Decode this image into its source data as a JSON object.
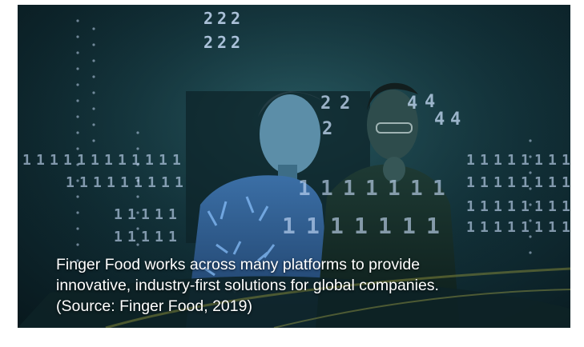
{
  "image": {
    "subject": "two men looking down at a table with projected digits",
    "overlay_digits": [
      "2",
      "1",
      "4"
    ]
  },
  "caption": {
    "line1": "Finger Food works across many platforms to provide",
    "line2": "innovative, industry-first solutions for global companies.",
    "line3": "(Source: Finger Food, 2019)"
  },
  "colors": {
    "background_dark": "#08181d",
    "digit_glow": "#cfe3ff",
    "caption_text": "#ffffff"
  }
}
